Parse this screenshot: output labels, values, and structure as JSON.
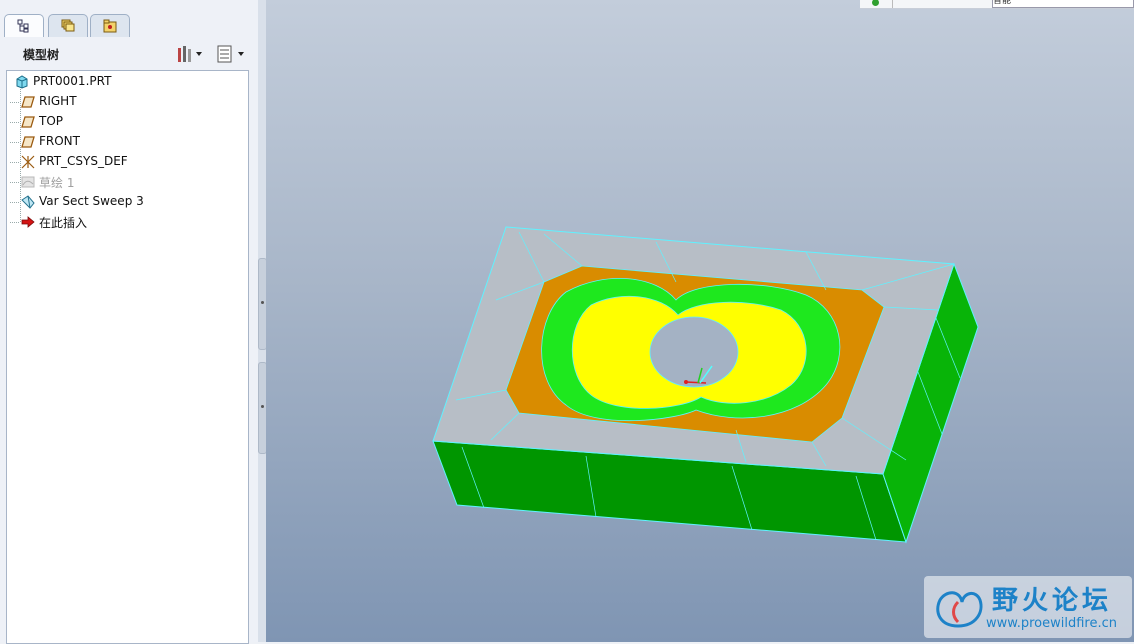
{
  "tabs": [
    {
      "icon": "model-tree-tab-icon",
      "active": true
    },
    {
      "icon": "layers-tab-icon",
      "active": false
    },
    {
      "icon": "folder-tab-icon",
      "active": false
    }
  ],
  "tree": {
    "title": "模型树",
    "root": "PRT0001.PRT",
    "items": [
      {
        "label": "RIGHT",
        "icon": "datum-plane-icon"
      },
      {
        "label": "TOP",
        "icon": "datum-plane-icon"
      },
      {
        "label": "FRONT",
        "icon": "datum-plane-icon"
      },
      {
        "label": "PRT_CSYS_DEF",
        "icon": "coordinate-system-icon"
      },
      {
        "label": "草绘 1",
        "icon": "sketch-icon",
        "suppressed": true
      },
      {
        "label": "Var Sect Sweep 3",
        "icon": "sweep-feature-icon"
      },
      {
        "label": "在此插入",
        "icon": "insert-here-arrow-icon"
      }
    ]
  },
  "topbar": {
    "field_value": "智能"
  },
  "watermark": {
    "title": "野火论坛",
    "url": "www.proewildfire.cn"
  },
  "colors": {
    "top_face": "#b7bec6",
    "pocket_face": "#d98c00",
    "fillet_face": "#1ee81e",
    "floor_face": "#ffff00",
    "side_face": "#00a000",
    "edge": "#5ff2ff"
  }
}
